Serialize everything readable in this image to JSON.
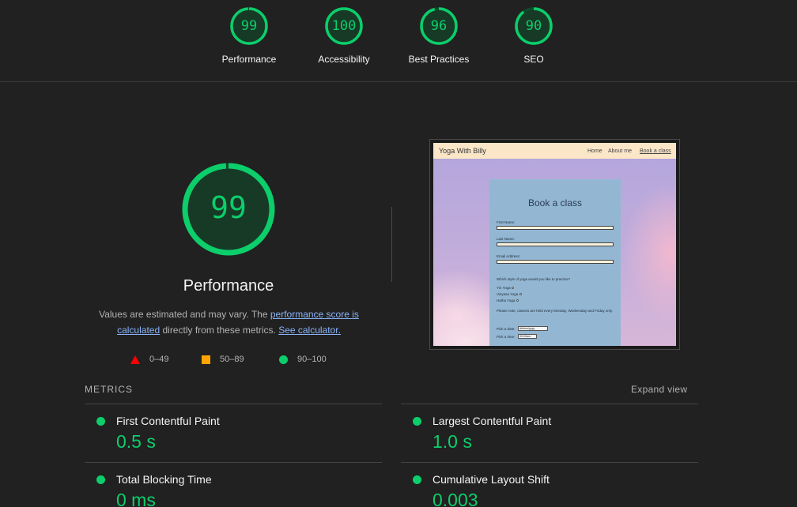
{
  "categories": [
    {
      "score": "99",
      "label": "Performance",
      "fraction": 0.99
    },
    {
      "score": "100",
      "label": "Accessibility",
      "fraction": 1.0
    },
    {
      "score": "96",
      "label": "Best Practices",
      "fraction": 0.96
    },
    {
      "score": "90",
      "label": "SEO",
      "fraction": 0.9
    }
  ],
  "performance": {
    "score": "99",
    "fraction": 0.99,
    "title": "Performance",
    "desc_prefix": "Values are estimated and may vary. The ",
    "desc_link1": "performance score is calculated",
    "desc_mid": " directly from these metrics. ",
    "desc_link2": "See calculator."
  },
  "legend": {
    "fail": "0–49",
    "average": "50–89",
    "pass": "90–100"
  },
  "colors": {
    "pass": "#0cce6b",
    "average": "#ffa400",
    "fail": "#ff0000",
    "link": "#8ab4f8"
  },
  "thumbnail": {
    "brand": "Yoga With Billy",
    "nav": [
      "Home",
      "About me",
      "Book a class"
    ],
    "form_title": "Book a class",
    "first_name": "First Name:",
    "last_name": "Last Name:",
    "email": "Email Address:",
    "question": "Which style of yoga would you like to practice?",
    "options": [
      "Yin Yoga",
      "Vinyasa Yoga",
      "Hatha Yoga"
    ],
    "note": "Please note, classes are held every Monday, Wednesday and Friday only.",
    "date_label": "Pick a date:",
    "date_value": "dd/mm/yyyy",
    "time_label": "Pick a time:",
    "time_value": "09:00am"
  },
  "metrics": {
    "heading": "METRICS",
    "expand": "Expand view",
    "items": [
      {
        "name": "First Contentful Paint",
        "value": "0.5 s"
      },
      {
        "name": "Largest Contentful Paint",
        "value": "1.0 s"
      },
      {
        "name": "Total Blocking Time",
        "value": "0 ms"
      },
      {
        "name": "Cumulative Layout Shift",
        "value": "0.003"
      }
    ]
  }
}
